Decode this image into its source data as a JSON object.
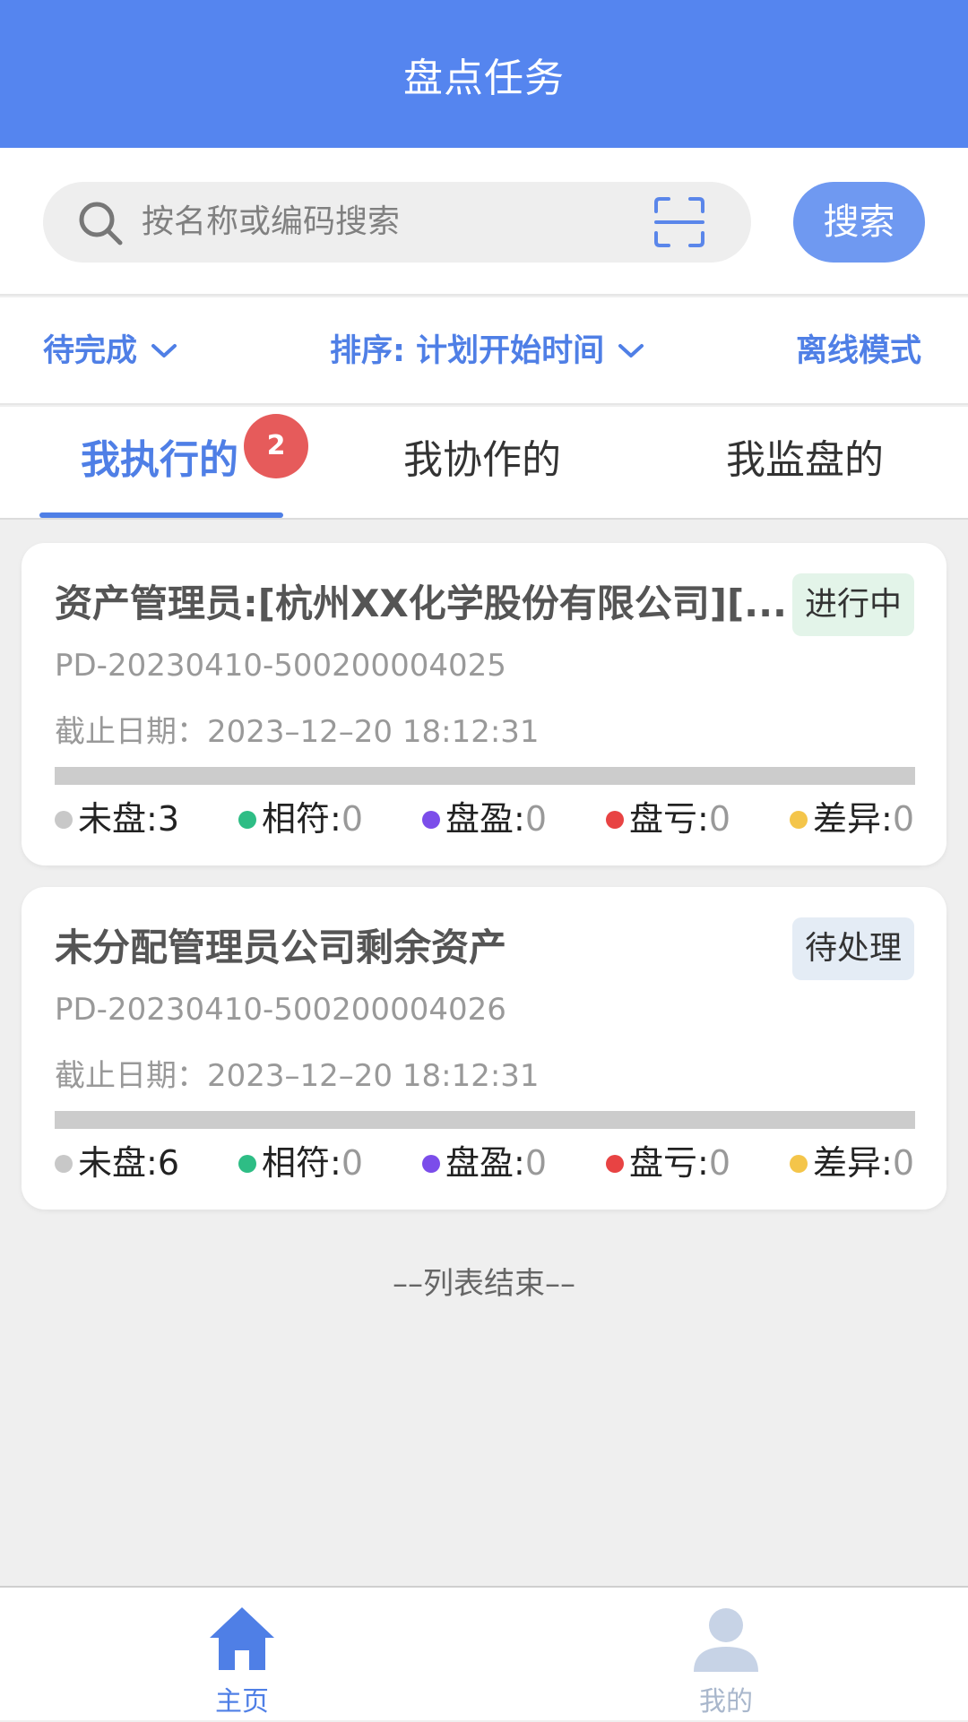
{
  "header": {
    "title": "盘点任务"
  },
  "search": {
    "placeholder": "按名称或编码搜索",
    "button_label": "搜索"
  },
  "filters": {
    "status_label": "待完成",
    "sort_label": "排序: 计划开始时间",
    "offline_label": "离线模式"
  },
  "tabs": [
    {
      "label": "我执行的",
      "badge": "2"
    },
    {
      "label": "我协作的"
    },
    {
      "label": "我监盘的"
    }
  ],
  "colors": {
    "accent": "#5585ef",
    "unchecked": "#c8c8c8",
    "match": "#2ebd85",
    "surplus": "#7b4dea",
    "loss": "#e84343",
    "diff": "#f4c54a"
  },
  "tasks": [
    {
      "title": "资产管理员:[杭州XX化学股份有限公司][...",
      "status": "进行中",
      "code": "PD-20230410-500200004025",
      "deadline": "截止日期：2023–12–20 18:12:31",
      "stats": {
        "unchecked_label": "未盘:",
        "unchecked": "3",
        "match_label": "相符:",
        "match": "0",
        "surplus_label": "盘盈:",
        "surplus": "0",
        "loss_label": "盘亏:",
        "loss": "0",
        "diff_label": "差异:",
        "diff": "0"
      }
    },
    {
      "title": "未分配管理员公司剩余资产",
      "status": "待处理",
      "code": "PD-20230410-500200004026",
      "deadline": "截止日期：2023–12–20 18:12:31",
      "stats": {
        "unchecked_label": "未盘:",
        "unchecked": "6",
        "match_label": "相符:",
        "match": "0",
        "surplus_label": "盘盈:",
        "surplus": "0",
        "loss_label": "盘亏:",
        "loss": "0",
        "diff_label": "差异:",
        "diff": "0"
      }
    }
  ],
  "list_end": "––列表结束––",
  "tabbar": [
    {
      "label": "主页",
      "icon": "home-icon"
    },
    {
      "label": "我的",
      "icon": "user-icon"
    }
  ]
}
